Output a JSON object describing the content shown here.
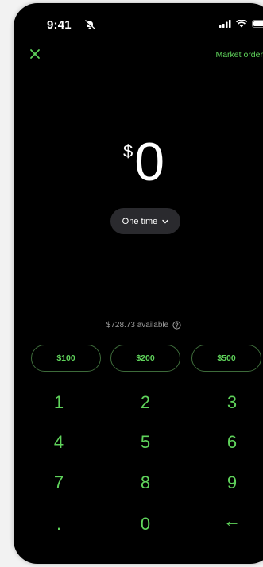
{
  "status": {
    "time": "9:41"
  },
  "header": {
    "close_icon": "close-icon",
    "order_type_label": "Market order"
  },
  "amount": {
    "currency": "$",
    "value": "0"
  },
  "frequency": {
    "label": "One time"
  },
  "balance": {
    "available_text": "$728.73 available"
  },
  "quick_amounts": [
    "$100",
    "$200",
    "$500"
  ],
  "keypad": [
    "1",
    "2",
    "3",
    "4",
    "5",
    "6",
    "7",
    "8",
    "9",
    ".",
    "0",
    "←"
  ],
  "colors": {
    "accent": "#5fd35b",
    "background": "#000000",
    "pill": "#2a2a2e"
  }
}
